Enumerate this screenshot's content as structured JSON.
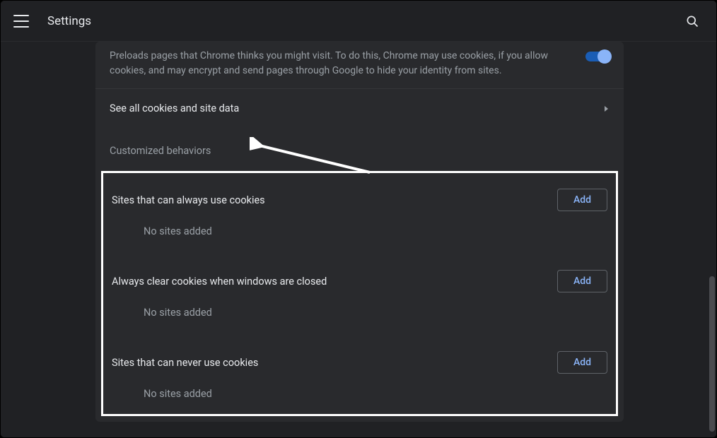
{
  "header": {
    "title": "Settings"
  },
  "preload": {
    "description": "Preloads pages that Chrome thinks you might visit. To do this, Chrome may use cookies, if you allow cookies, and may encrypt and send pages through Google to hide your identity from sites."
  },
  "see_all_cookies": {
    "label": "See all cookies and site data"
  },
  "customized": {
    "header": "Customized behaviors",
    "add_label": "Add",
    "no_sites": "No sites added",
    "groups": [
      {
        "title": "Sites that can always use cookies"
      },
      {
        "title": "Always clear cookies when windows are closed"
      },
      {
        "title": "Sites that can never use cookies"
      }
    ]
  }
}
